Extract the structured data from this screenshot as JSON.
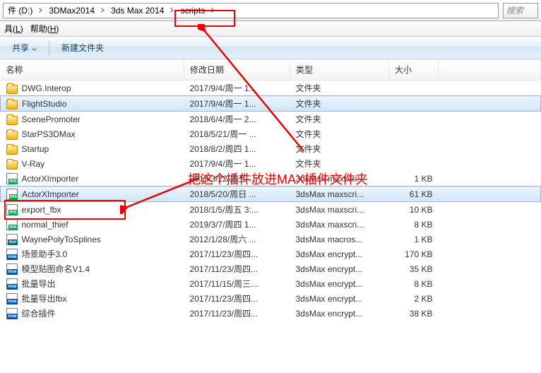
{
  "breadcrumb": {
    "root_label": "件 (D:)",
    "items": [
      "3DMax2014",
      "3ds Max 2014",
      "scripts"
    ]
  },
  "search": {
    "placeholder": "搜索"
  },
  "menu": {
    "tools": "具",
    "tools_key": "L",
    "help": "帮助",
    "help_key": "H"
  },
  "toolbar": {
    "share": "共享",
    "newfolder": "新建文件夹"
  },
  "columns": {
    "name": "名称",
    "date": "修改日期",
    "type": "类型",
    "size": "大小"
  },
  "files": [
    {
      "icon": "folder",
      "name": "DWG.Interop",
      "date": "2017/9/4/周一 1...",
      "type": "文件夹",
      "size": ""
    },
    {
      "icon": "folder",
      "name": "FlightStudio",
      "date": "2017/9/4/周一 1...",
      "type": "文件夹",
      "size": "",
      "selected": true
    },
    {
      "icon": "folder",
      "name": "ScenePromoter",
      "date": "2018/6/4/周一 2...",
      "type": "文件夹",
      "size": ""
    },
    {
      "icon": "folder",
      "name": "StarPS3DMax",
      "date": "2018/5/21/周一 ...",
      "type": "文件夹",
      "size": ""
    },
    {
      "icon": "folder",
      "name": "Startup",
      "date": "2018/8/2/周四 1...",
      "type": "文件夹",
      "size": ""
    },
    {
      "icon": "folder",
      "name": "V-Ray",
      "date": "2017/9/4/周一 1...",
      "type": "文件夹",
      "size": ""
    },
    {
      "icon": "ms",
      "name": "ActorXImporter",
      "date": "2019/3/22/周五 ...",
      "type": "3dsMax maxscri...",
      "size": "1 KB"
    },
    {
      "icon": "ms",
      "name": "ActorXImporter",
      "date": "2018/5/20/周日 ...",
      "type": "3dsMax maxscri...",
      "size": "61 KB",
      "selected": true
    },
    {
      "icon": "ms",
      "name": "export_fbx",
      "date": "2018/1/5/周五 3:...",
      "type": "3dsMax maxscri...",
      "size": "10 KB"
    },
    {
      "icon": "ms",
      "name": "normal_thief",
      "date": "2019/3/7/周四 1...",
      "type": "3dsMax maxscri...",
      "size": "8 KB"
    },
    {
      "icon": "mcr",
      "name": "WaynePolyToSplines",
      "date": "2012/1/28/周六 ...",
      "type": "3dsMax macros...",
      "size": "1 KB"
    },
    {
      "icon": "mse",
      "name": "场景助手3.0",
      "date": "2017/11/23/周四...",
      "type": "3dsMax encrypt...",
      "size": "170 KB"
    },
    {
      "icon": "mse",
      "name": "模型贴图命名V1.4",
      "date": "2017/11/23/周四...",
      "type": "3dsMax encrypt...",
      "size": "35 KB"
    },
    {
      "icon": "mse",
      "name": "批量导出",
      "date": "2017/11/15/周三...",
      "type": "3dsMax encrypt...",
      "size": "8 KB"
    },
    {
      "icon": "mse",
      "name": "批量导出fbx",
      "date": "2017/11/23/周四...",
      "type": "3dsMax encrypt...",
      "size": "2 KB"
    },
    {
      "icon": "mse",
      "name": "综合插件",
      "date": "2017/11/23/周四...",
      "type": "3dsMax encrypt...",
      "size": "38 KB"
    }
  ],
  "annotations": {
    "text": "把这个插件放进MAX插件文件夹"
  }
}
